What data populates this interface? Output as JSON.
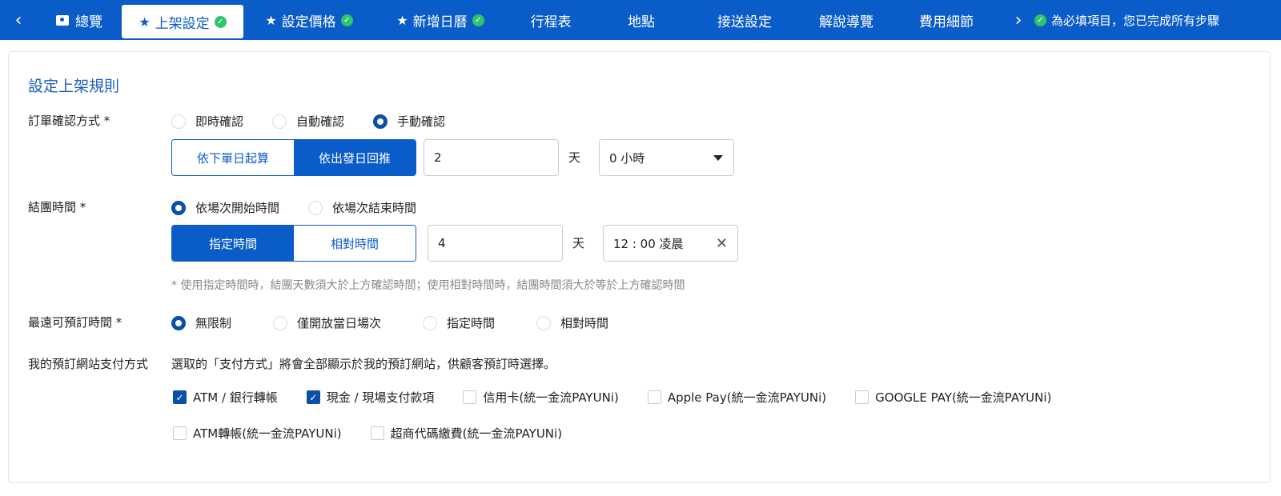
{
  "nav": {
    "tabs": [
      {
        "label": "總覽"
      },
      {
        "label": "上架設定"
      },
      {
        "label": "設定價格"
      },
      {
        "label": "新增日曆"
      },
      {
        "label": "行程表"
      },
      {
        "label": "地點"
      },
      {
        "label": "接送設定"
      },
      {
        "label": "解說導覽"
      },
      {
        "label": "費用細節"
      }
    ],
    "status": "為必填項目，您已完成所有步驟"
  },
  "panel": {
    "title": "設定上架規則",
    "order_confirm": {
      "label": "訂單確認方式 *",
      "options": [
        "即時確認",
        "自動確認",
        "手動確認"
      ],
      "selected": "手動確認",
      "mode_buttons": [
        "依下單日起算",
        "依出發日回推"
      ],
      "days_value": "2",
      "days_unit": "天",
      "hours_value": "0 小時"
    },
    "close_time": {
      "label": "結團時間 *",
      "options": [
        "依場次開始時間",
        "依場次結束時間"
      ],
      "selected": "依場次開始時間",
      "mode_buttons": [
        "指定時間",
        "相對時間"
      ],
      "days_value": "4",
      "days_unit": "天",
      "time_value": "12 : 00 凌晨",
      "hint": "* 使用指定時間時，結團天數須大於上方確認時間；使用相對時間時，結團時間須大於等於上方確認時間"
    },
    "max_booking": {
      "label": "最遠可預訂時間 *",
      "options": [
        "無限制",
        "僅開放當日場次",
        "指定時間",
        "相對時間"
      ],
      "selected": "無限制"
    },
    "payment": {
      "label": "我的預訂網站支付方式",
      "description": "選取的「支付方式」將會全部顯示於我的預訂網站，供顧客預訂時選擇。",
      "methods": [
        {
          "label": "ATM / 銀行轉帳",
          "checked": true
        },
        {
          "label": "現金 / 現場支付款項",
          "checked": true
        },
        {
          "label": "信用卡(統一金流PAYUNi)",
          "checked": false
        },
        {
          "label": "Apple Pay(統一金流PAYUNi)",
          "checked": false
        },
        {
          "label": "GOOGLE PAY(統一金流PAYUNi)",
          "checked": false
        },
        {
          "label": "ATM轉帳(統一金流PAYUNi)",
          "checked": false
        },
        {
          "label": "超商代碼繳費(統一金流PAYUNi)",
          "checked": false
        }
      ]
    }
  },
  "colors": {
    "primary": "#0a5cc8",
    "success": "#2fc56a",
    "title": "#1b5fbf"
  }
}
